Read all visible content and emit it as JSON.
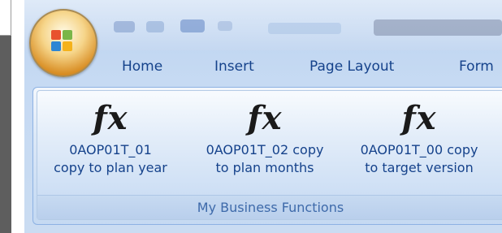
{
  "tabs": [
    {
      "label": "Home"
    },
    {
      "label": "Insert"
    },
    {
      "label": "Page Layout"
    },
    {
      "label": "Form"
    }
  ],
  "ribbon": {
    "group_title": "My Business Functions",
    "buttons": [
      {
        "icon": "fx",
        "line1": "0AOP01T_01",
        "line2": "copy to plan year"
      },
      {
        "icon": "fx",
        "line1": "0AOP01T_02 copy",
        "line2": "to plan months"
      },
      {
        "icon": "fx",
        "line1": "0AOP01T_00 copy",
        "line2": "to target version"
      }
    ]
  },
  "colors": {
    "accent_text": "#15428b",
    "ribbon_background": "#dce8f7"
  }
}
